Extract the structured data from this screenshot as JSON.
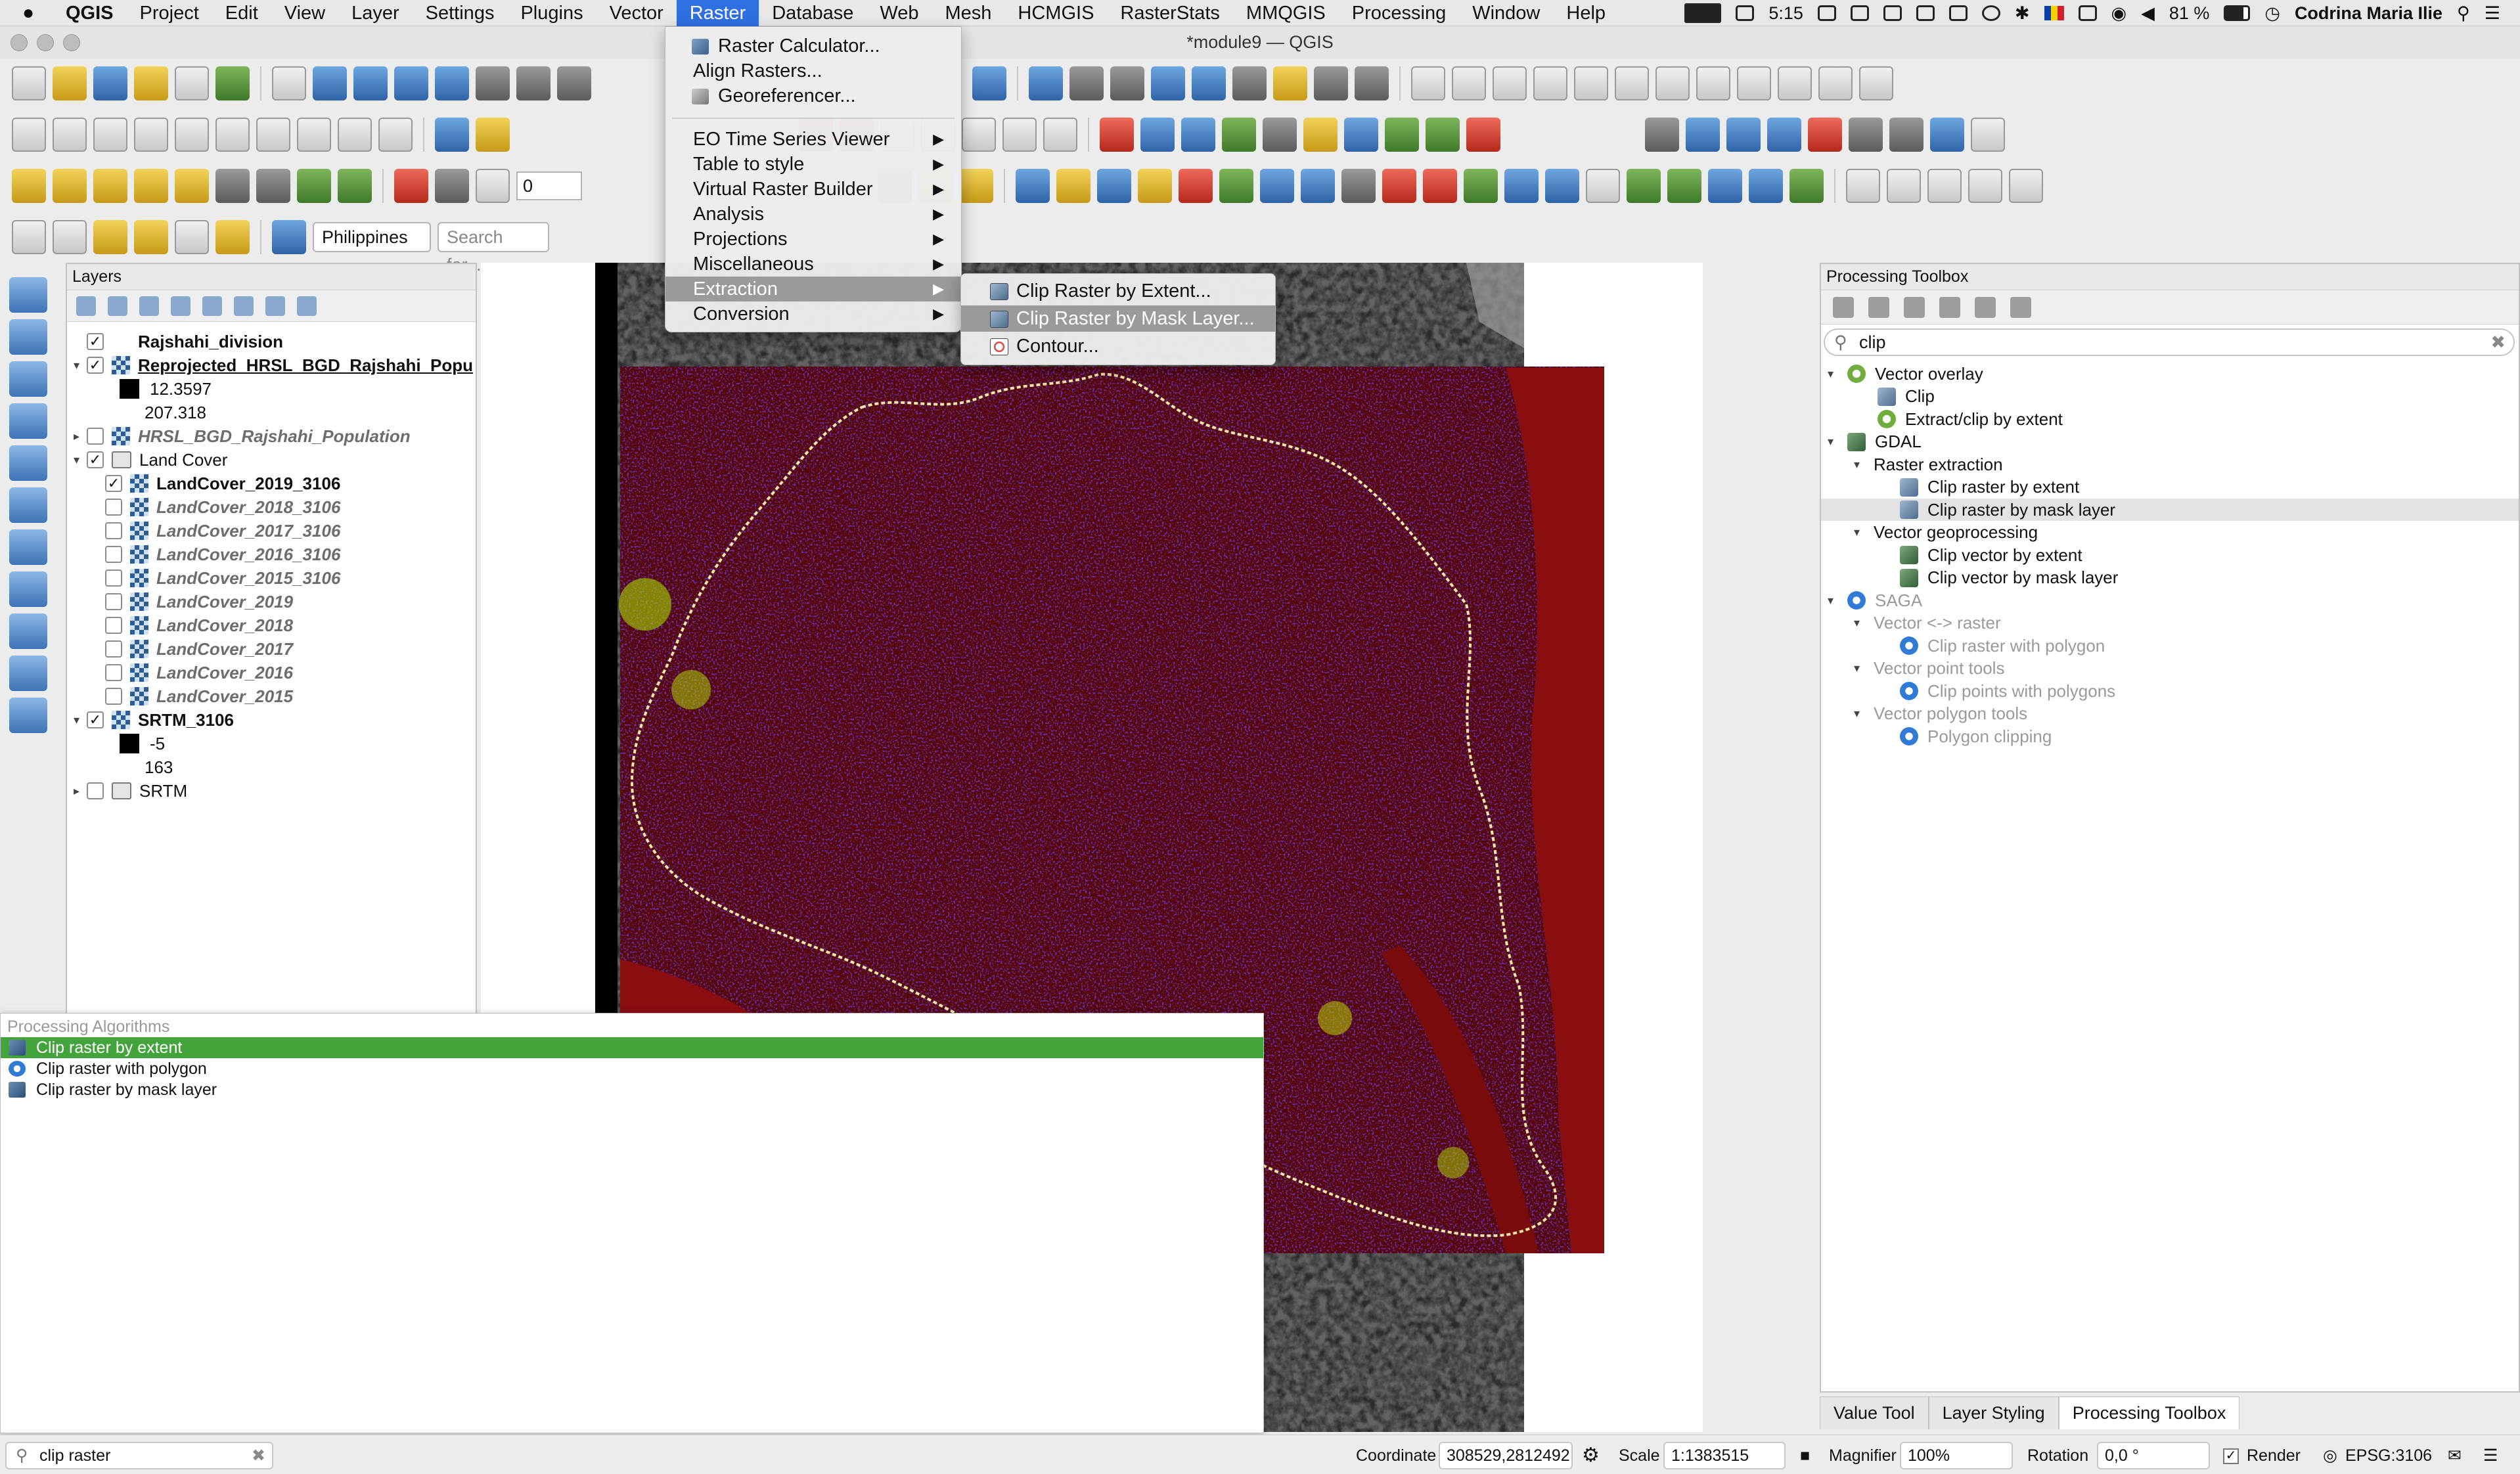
{
  "menubar": {
    "apple": "",
    "items": [
      "QGIS",
      "Project",
      "Edit",
      "View",
      "Layer",
      "Settings",
      "Plugins",
      "Vector",
      "Raster",
      "Database",
      "Web",
      "Mesh",
      "HCMGIS",
      "RasterStats",
      "MMQGIS",
      "Processing",
      "Window",
      "Help"
    ],
    "active": "Raster",
    "clock": "5:15",
    "battery": "81 %",
    "user": "Codrina Maria Ilie"
  },
  "window": {
    "title": "*module9 — QGIS"
  },
  "toolbar": {
    "layer_combo": "Philippines",
    "search_placeholder": "Search for...",
    "snap_value": "0"
  },
  "raster_menu": {
    "calculator": "Raster Calculator...",
    "align": "Align Rasters...",
    "georef": "Georeferencer...",
    "eo": "EO Time Series Viewer",
    "table_style": "Table to style",
    "vrt": "Virtual Raster Builder",
    "analysis": "Analysis",
    "projections": "Projections",
    "misc": "Miscellaneous",
    "extraction": "Extraction",
    "conversion": "Conversion"
  },
  "extraction_submenu": {
    "extent": "Clip Raster by Extent...",
    "mask": "Clip Raster by Mask Layer...",
    "contour": "Contour..."
  },
  "layers_panel": {
    "title": "Layers",
    "rows": [
      {
        "label": "Rajshahi_division"
      },
      {
        "label": "Reprojected_HRSL_BGD_Rajshahi_Popu"
      },
      {
        "label": "12.3597"
      },
      {
        "label": "207.318"
      },
      {
        "label": "HRSL_BGD_Rajshahi_Population"
      },
      {
        "label": "Land Cover"
      },
      {
        "label": "LandCover_2019_3106"
      },
      {
        "label": "LandCover_2018_3106"
      },
      {
        "label": "LandCover_2017_3106"
      },
      {
        "label": "LandCover_2016_3106"
      },
      {
        "label": "LandCover_2015_3106"
      },
      {
        "label": "LandCover_2019"
      },
      {
        "label": "LandCover_2018"
      },
      {
        "label": "LandCover_2017"
      },
      {
        "label": "LandCover_2016"
      },
      {
        "label": "LandCover_2015"
      },
      {
        "label": "SRTM_3106"
      },
      {
        "label": "-5"
      },
      {
        "label": "163"
      },
      {
        "label": "SRTM"
      }
    ]
  },
  "locator": {
    "group": "Processing Algorithms",
    "items": [
      "Clip raster by extent",
      "Clip raster with polygon",
      "Clip raster by mask layer"
    ]
  },
  "toolbox": {
    "title": "Processing Toolbox",
    "search": "clip",
    "rows": [
      "Vector overlay",
      "Clip",
      "Extract/clip by extent",
      "GDAL",
      "Raster extraction",
      "Clip raster by extent",
      "Clip raster by mask layer",
      "Vector geoprocessing",
      "Clip vector by extent",
      "Clip vector by mask layer",
      "SAGA",
      "Vector <-> raster",
      "Clip raster with polygon",
      "Vector point tools",
      "Clip points with polygons",
      "Vector polygon tools",
      "Polygon clipping"
    ]
  },
  "dock_tabs": [
    "Value Tool",
    "Layer Styling",
    "Processing Toolbox"
  ],
  "statusbar": {
    "locator_text": "clip raster",
    "coordinate_label": "Coordinate",
    "coordinate": "308529,2812492",
    "scale_label": "Scale",
    "scale": "1:1383515",
    "magnifier_label": "Magnifier",
    "magnifier": "100%",
    "rotation_label": "Rotation",
    "rotation": "0,0 °",
    "render_label": "Render",
    "crs": "EPSG:3106"
  },
  "colors": {
    "accent": "#2f6fe0",
    "selection": "#44a43c",
    "menu_highlight": "#9a9a9a"
  }
}
